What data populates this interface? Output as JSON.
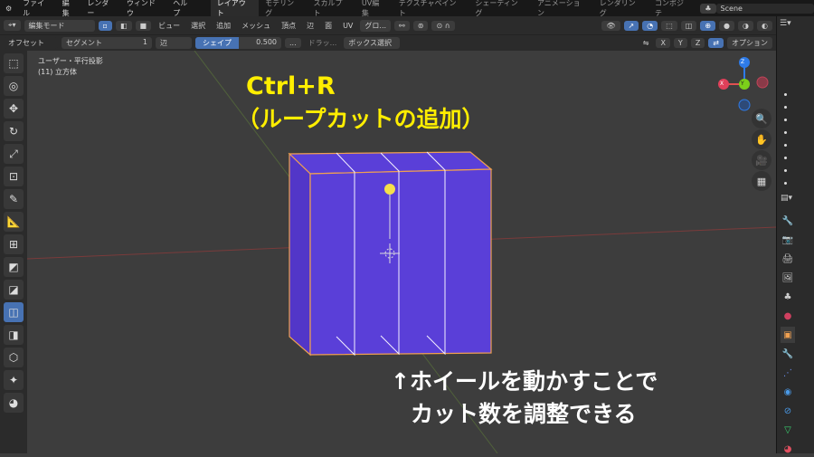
{
  "menubar": {
    "items": [
      "ファイル",
      "編集",
      "レンダー",
      "ウィンドウ",
      "ヘルプ"
    ],
    "workspaces": [
      "レイアウト",
      "モデリング",
      "スカルプト",
      "UV編集",
      "テクスチャペイント",
      "シェーディング",
      "アニメーション",
      "レンダリング",
      "コンポジテ"
    ],
    "active_workspace": "レイアウト",
    "scene": "Scene"
  },
  "header": {
    "mode": "編集モード",
    "menus": [
      "ビュー",
      "選択",
      "追加",
      "メッシュ",
      "頂点",
      "辺",
      "面",
      "UV"
    ],
    "transform": "グロ..."
  },
  "tool_settings": {
    "offset": "オフセット",
    "segment_label": "セグメント",
    "segment_value": "1",
    "edge": "辺",
    "shape_label": "シェイプ",
    "shape_value": "0.500",
    "more": "...",
    "drag": "ドラッ...",
    "box_select": "ボックス選択",
    "axes": [
      "X",
      "Y",
      "Z"
    ],
    "options": "オプション"
  },
  "viewport": {
    "view_name": "ユーザー・平行投影",
    "object": "(11) 立方体",
    "gizmo": {
      "x": "X",
      "y": "Y",
      "z": "Z"
    }
  },
  "overlay": {
    "title": "Ctrl+R",
    "subtitle": "（ループカットの追加）",
    "note1": "↑ホイールを動かすことで",
    "note2": "カット数を調整できる"
  },
  "colors": {
    "accent": "#4772b3",
    "cube_face": "#5a3fd8",
    "edge": "#f0a050",
    "overlay_yellow": "#ffee00"
  }
}
